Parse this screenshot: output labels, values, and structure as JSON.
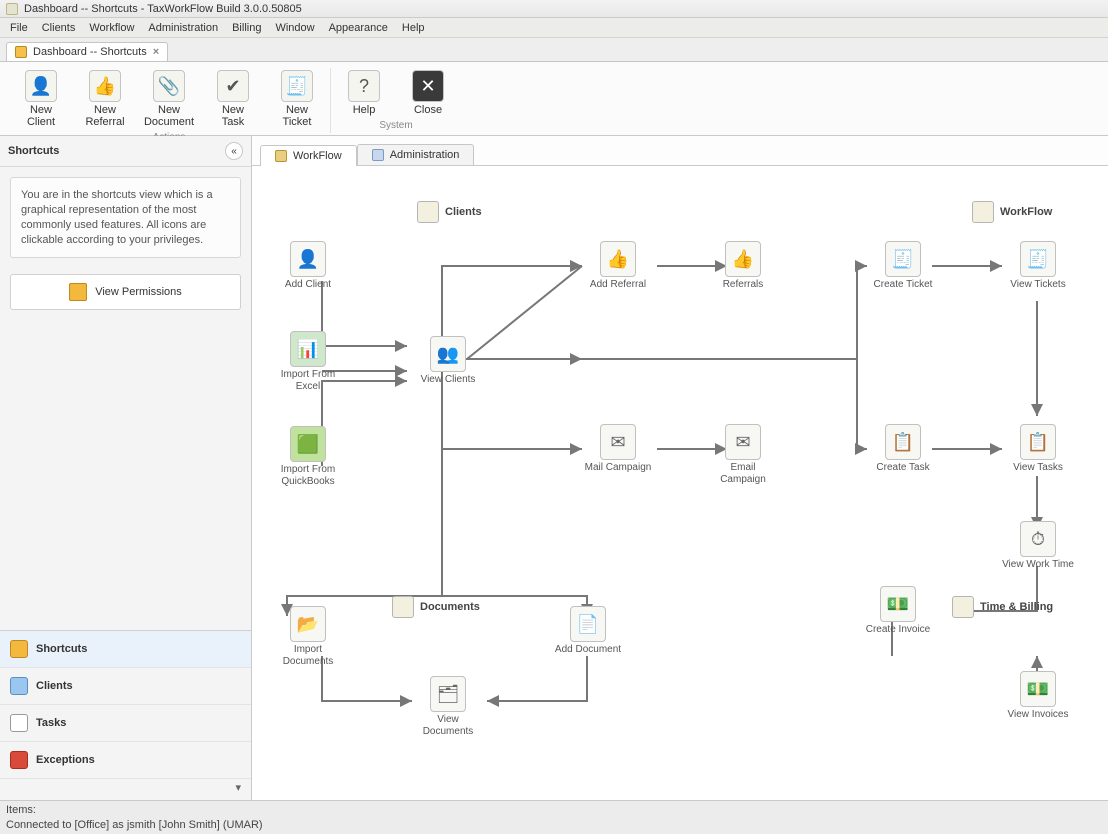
{
  "title": "Dashboard -- Shortcuts - TaxWorkFlow Build 3.0.0.50805",
  "menu": [
    "File",
    "Clients",
    "Workflow",
    "Administration",
    "Billing",
    "Window",
    "Appearance",
    "Help"
  ],
  "doctab": {
    "label": "Dashboard -- Shortcuts",
    "close": "×"
  },
  "ribbon": {
    "actions_label": "Actions",
    "system_label": "System",
    "actions": [
      {
        "l1": "New",
        "l2": "Client"
      },
      {
        "l1": "New",
        "l2": "Referral"
      },
      {
        "l1": "New",
        "l2": "Document"
      },
      {
        "l1": "New",
        "l2": "Task"
      },
      {
        "l1": "New",
        "l2": "Ticket"
      }
    ],
    "system": [
      {
        "l1": "Help",
        "l2": ""
      },
      {
        "l1": "Close",
        "l2": ""
      }
    ]
  },
  "sidebar": {
    "title": "Shortcuts",
    "info": "You are in the shortcuts view which is a graphical representation of the most commonly used features. All icons are clickable according to your privileges.",
    "perm_label": "View Permissions",
    "nav": [
      "Shortcuts",
      "Clients",
      "Tasks",
      "Exceptions"
    ]
  },
  "content_tabs": [
    "WorkFlow",
    "Administration"
  ],
  "sections": {
    "clients": "Clients",
    "workflow": "WorkFlow",
    "documents": "Documents",
    "timebilling": "Time & Billing"
  },
  "nodes": {
    "add_client": "Add Client",
    "import_excel": "Import From Excel",
    "import_qb": "Import From QuickBooks",
    "view_clients": "View Clients",
    "add_referral": "Add Referral",
    "referrals": "Referrals",
    "mail_campaign": "Mail Campaign",
    "email_campaign": "Email Campaign",
    "create_ticket": "Create Ticket",
    "view_tickets": "View Tickets",
    "create_task": "Create Task",
    "view_tasks": "View Tasks",
    "view_worktime": "View Work Time",
    "create_invoice": "Create Invoice",
    "view_invoices": "View Invoices",
    "import_docs": "Import Documents",
    "add_document": "Add Document",
    "view_docs": "View Documents"
  },
  "status": {
    "items": "Items:",
    "conn": "Connected to [Office] as jsmith [John Smith]  (UMAR)"
  }
}
